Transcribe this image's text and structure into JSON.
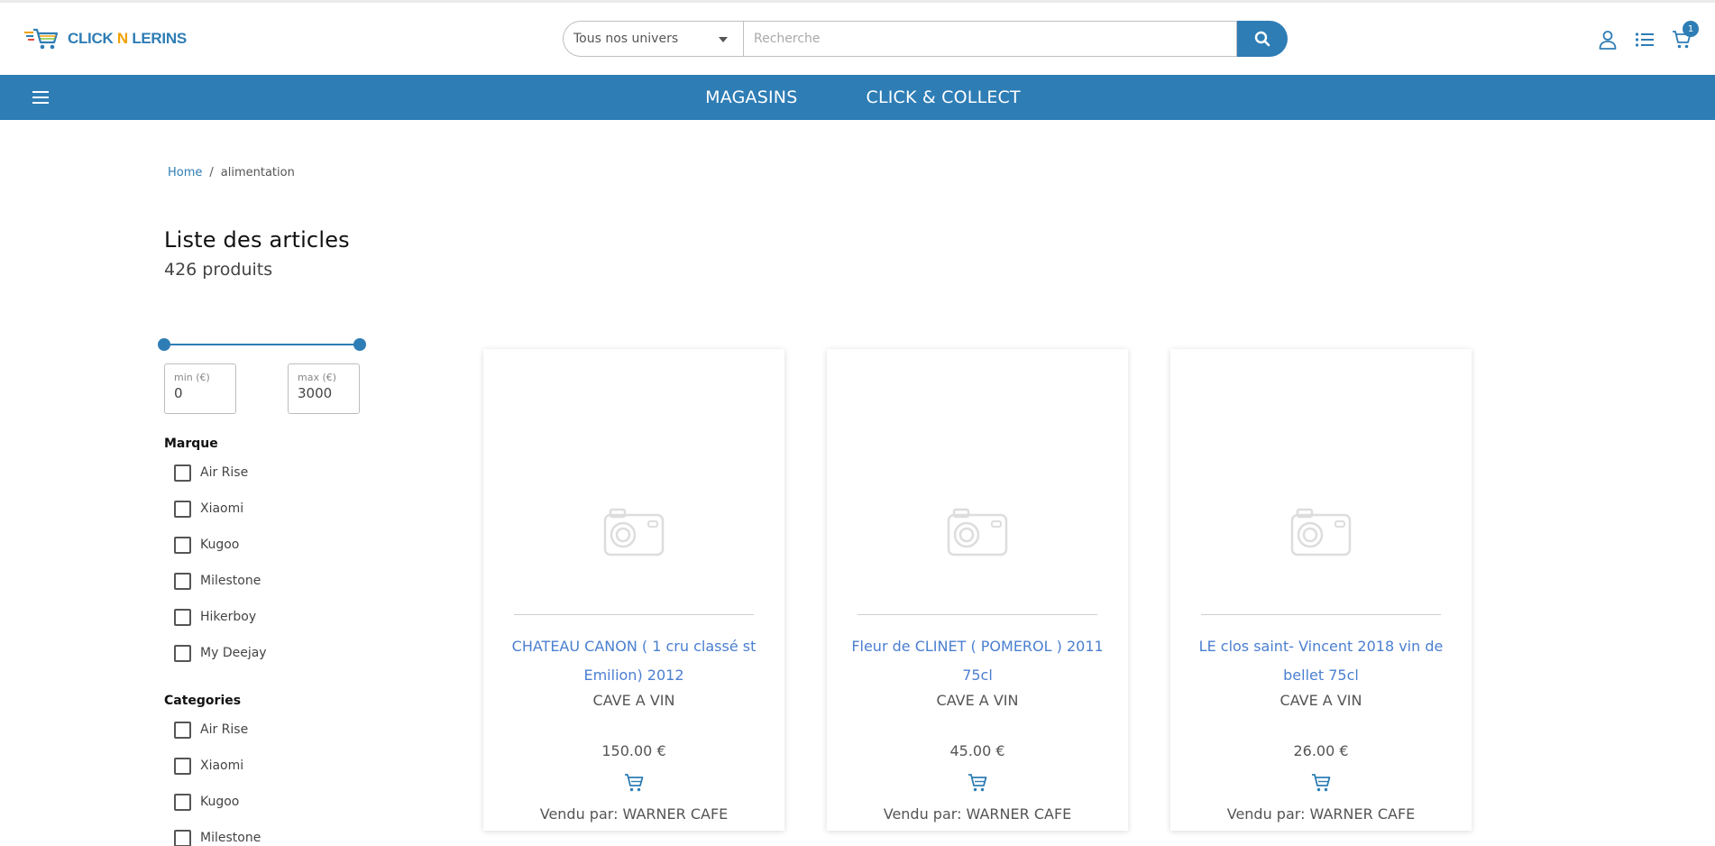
{
  "header": {
    "logo_text_a": "CLICK",
    "logo_text_b": "N",
    "logo_text_c": "LERINS",
    "search_category": "Tous nos univers",
    "search_placeholder": "Recherche",
    "cart_count": "1"
  },
  "nav": {
    "items": [
      "MAGASINS",
      "CLICK & COLLECT"
    ]
  },
  "breadcrumb": {
    "home": "Home",
    "separator": "/",
    "current": "alimentation"
  },
  "listing": {
    "title": "Liste des articles",
    "count": "426 produits"
  },
  "price_filter": {
    "min_label": "min (€)",
    "max_label": "max (€)",
    "min_value": "0",
    "max_value": "3000"
  },
  "filters": {
    "marque": {
      "title": "Marque",
      "items": [
        "Air Rise",
        "Xiaomi",
        "Kugoo",
        "Milestone",
        "Hikerboy",
        "My Deejay"
      ]
    },
    "categories": {
      "title": "Categories",
      "items": [
        "Air Rise",
        "Xiaomi",
        "Kugoo",
        "Milestone"
      ]
    }
  },
  "products": [
    {
      "name": "CHATEAU CANON ( 1 cru classé st Emilion) 2012",
      "category": "CAVE A VIN",
      "price": "150.00 €",
      "seller": "Vendu par: WARNER CAFE"
    },
    {
      "name": "Fleur de CLINET ( POMEROL ) 2011 75cl",
      "category": "CAVE A VIN",
      "price": "45.00 €",
      "seller": "Vendu par: WARNER CAFE"
    },
    {
      "name": "LE clos saint- Vincent 2018 vin de bellet 75cl",
      "category": "CAVE A VIN",
      "price": "26.00 €",
      "seller": "Vendu par: WARNER CAFE"
    }
  ],
  "colors": {
    "primary": "#2e7db5",
    "accent": "#f2a100",
    "product_link": "#4b7fd0"
  }
}
